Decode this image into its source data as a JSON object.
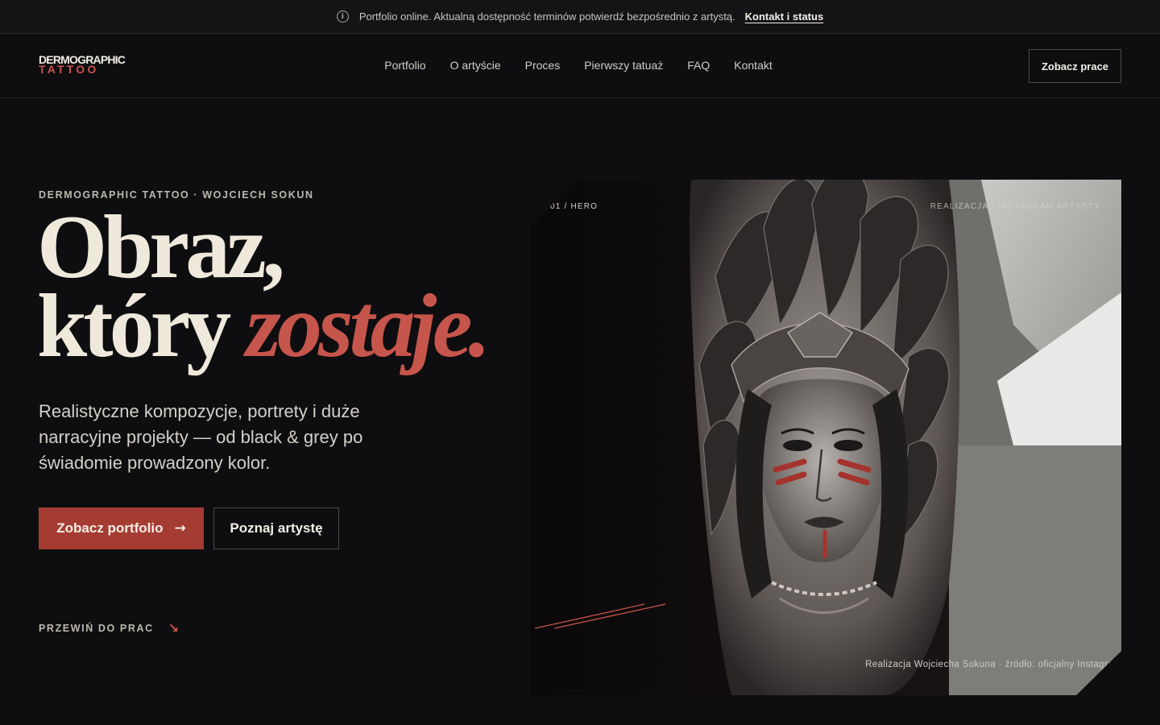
{
  "announcement": {
    "icon": "info-icon",
    "text": "Portfolio online. Aktualną dostępność terminów potwierdź bezpośrednio z artystą.",
    "link_label": "Kontakt i status"
  },
  "header": {
    "logo_top": "DERMOGRAPHIC",
    "logo_bottom": "TATTOO",
    "nav": [
      "Portfolio",
      "O artyście",
      "Proces",
      "Pierwszy tatuaż",
      "FAQ",
      "Kontakt"
    ],
    "cta_label": "Zobacz prace"
  },
  "hero": {
    "eyebrow": "DERMOGRAPHIC TATTOO · WOJCIECH SOKUN",
    "headline_line1": "Obraz,",
    "headline_line2_plain": "który",
    "headline_line2_accent": "zostaje.",
    "lede": "Realistyczne kompozycje, portrety i duże narracyjne projekty — od black & grey po świadomie prowadzony kolor.",
    "primary_button": "Zobacz portfolio",
    "primary_icon": "arrow-right-icon",
    "secondary_button": "Poznaj artystę",
    "scroll_label": "PRZEWIŃ DO PRAC",
    "scroll_icon": "arrow-down-right-icon"
  },
  "media": {
    "tag_left": "01 / HERO",
    "tag_right": "REALIZACJA / INSTAGRAM ARTYSTY",
    "caption": "Realizacja Wojciecha Sokuna · źródło: oficjalny Instagram",
    "image_subject": "black & grey forearm tattoo of a woman wearing a feathered headdress"
  },
  "colors": {
    "background": "#0e0e10",
    "accent": "#c6554b",
    "button_primary": "#a53c33",
    "text": "#efe9dc"
  }
}
